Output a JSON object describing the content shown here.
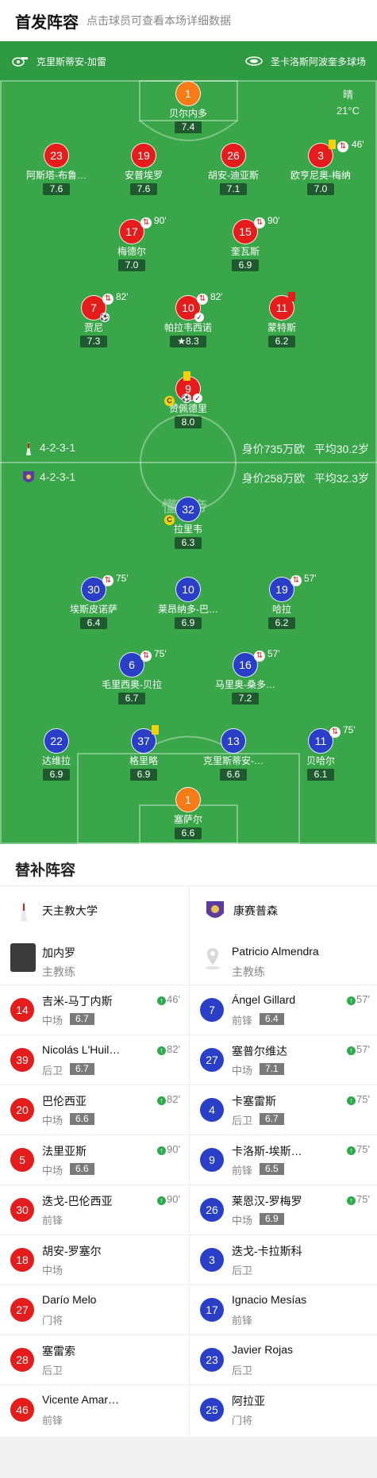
{
  "header": {
    "title": "首发阵容",
    "subtitle": "点击球员可查看本场详细数据"
  },
  "match": {
    "coach_home_icon": "whistle-icon",
    "referee": "克里斯蒂安-加雷",
    "venue": "圣卡洛斯阿波奎多球场",
    "weather": "晴",
    "temperature": "21°C"
  },
  "home_form": {
    "formation": "4-2-3-1",
    "value": "身价735万欧",
    "age": "平均30.2岁"
  },
  "away_form": {
    "formation": "4-2-3-1",
    "value": "身价258万欧",
    "age": "平均32.3岁"
  },
  "watermark": "懂球帝",
  "home_players": [
    {
      "num": "1",
      "name": "贝尔内多",
      "rating": "7.4"
    },
    {
      "num": "23",
      "name": "阿斯塔-布鲁…",
      "rating": "7.6"
    },
    {
      "num": "19",
      "name": "安普埃罗",
      "rating": "7.6"
    },
    {
      "num": "26",
      "name": "胡安-迪亚斯",
      "rating": "7.1"
    },
    {
      "num": "3",
      "name": "欧亨尼奥-梅纳",
      "rating": "7.0",
      "subtime": "46'"
    },
    {
      "num": "17",
      "name": "梅德尔",
      "rating": "7.0",
      "subtime": "90'"
    },
    {
      "num": "15",
      "name": "奎瓦斯",
      "rating": "6.9",
      "subtime": "90'"
    },
    {
      "num": "7",
      "name": "贾尼",
      "rating": "7.3",
      "subtime": "82'"
    },
    {
      "num": "10",
      "name": "帕拉韦西诺",
      "rating": "8.3",
      "subtime": "82'"
    },
    {
      "num": "11",
      "name": "蒙特斯",
      "rating": "6.2"
    },
    {
      "num": "9",
      "name": "赞佩德里",
      "rating": "8.0"
    }
  ],
  "away_players": [
    {
      "num": "32",
      "name": "拉里韦",
      "rating": "6.3"
    },
    {
      "num": "30",
      "name": "埃斯皮诺萨",
      "rating": "6.4",
      "subtime": "75'"
    },
    {
      "num": "10",
      "name": "莱昂纳多-巴…",
      "rating": "6.9"
    },
    {
      "num": "19",
      "name": "哈拉",
      "rating": "6.2",
      "subtime": "57'"
    },
    {
      "num": "6",
      "name": "毛里西奥-贝拉",
      "rating": "6.7",
      "subtime": "75'"
    },
    {
      "num": "16",
      "name": "马里奥-桑多…",
      "rating": "7.2",
      "subtime": "57'"
    },
    {
      "num": "22",
      "name": "达维拉",
      "rating": "6.9"
    },
    {
      "num": "37",
      "name": "格里略",
      "rating": "6.9"
    },
    {
      "num": "13",
      "name": "克里斯蒂安-…",
      "rating": "6.6"
    },
    {
      "num": "11",
      "name": "贝哈尔",
      "rating": "6.1",
      "subtime": "75'"
    },
    {
      "num": "1",
      "name": "塞萨尔",
      "rating": "6.6"
    }
  ],
  "subs_section": {
    "title": "替补阵容"
  },
  "left_team": {
    "name": "天主教大学",
    "coach": {
      "name": "加内罗",
      "role": "主教练"
    },
    "subs": [
      {
        "num": "14",
        "name": "吉米-马丁内斯",
        "pos": "中场",
        "rating": "6.7",
        "in": "46'"
      },
      {
        "num": "39",
        "name": "Nicolás L'Huil…",
        "pos": "后卫",
        "rating": "6.7",
        "in": "82'"
      },
      {
        "num": "20",
        "name": "巴伦西亚",
        "pos": "中场",
        "rating": "6.6",
        "in": "82'"
      },
      {
        "num": "5",
        "name": "法里亚斯",
        "pos": "中场",
        "rating": "6.6",
        "in": "90'"
      },
      {
        "num": "30",
        "name": "迭戈-巴伦西亚",
        "pos": "前锋",
        "in": "90'"
      },
      {
        "num": "18",
        "name": "胡安-罗塞尔",
        "pos": "中场"
      },
      {
        "num": "27",
        "name": "Darío Melo",
        "pos": "门将"
      },
      {
        "num": "28",
        "name": "塞雷索",
        "pos": "后卫"
      },
      {
        "num": "46",
        "name": "Vicente Amar…",
        "pos": "前锋"
      }
    ]
  },
  "right_team": {
    "name": "康赛普森",
    "coach": {
      "name": "Patricio Almendra",
      "role": "主教练"
    },
    "subs": [
      {
        "num": "7",
        "name": "Ángel Gillard",
        "pos": "前锋",
        "rating": "6.4",
        "in": "57'"
      },
      {
        "num": "27",
        "name": "塞普尔维达",
        "pos": "中场",
        "rating": "7.1",
        "in": "57'"
      },
      {
        "num": "4",
        "name": "卡塞雷斯",
        "pos": "后卫",
        "rating": "6.7",
        "in": "75'"
      },
      {
        "num": "9",
        "name": "卡洛斯-埃斯…",
        "pos": "前锋",
        "rating": "6.5",
        "in": "75'"
      },
      {
        "num": "26",
        "name": "莱恩汉-罗梅罗",
        "pos": "中场",
        "rating": "6.9",
        "in": "75'"
      },
      {
        "num": "3",
        "name": "迭戈-卡拉斯科",
        "pos": "后卫"
      },
      {
        "num": "17",
        "name": "Ignacio Mesías",
        "pos": "前锋"
      },
      {
        "num": "23",
        "name": "Javier Rojas",
        "pos": "后卫"
      },
      {
        "num": "25",
        "name": "阿拉亚",
        "pos": "门将"
      }
    ]
  },
  "colors": {
    "home": "#e41c1c",
    "away": "#2a3fc8",
    "keeper": "#f47b16",
    "pitch": "#3aa64a"
  }
}
